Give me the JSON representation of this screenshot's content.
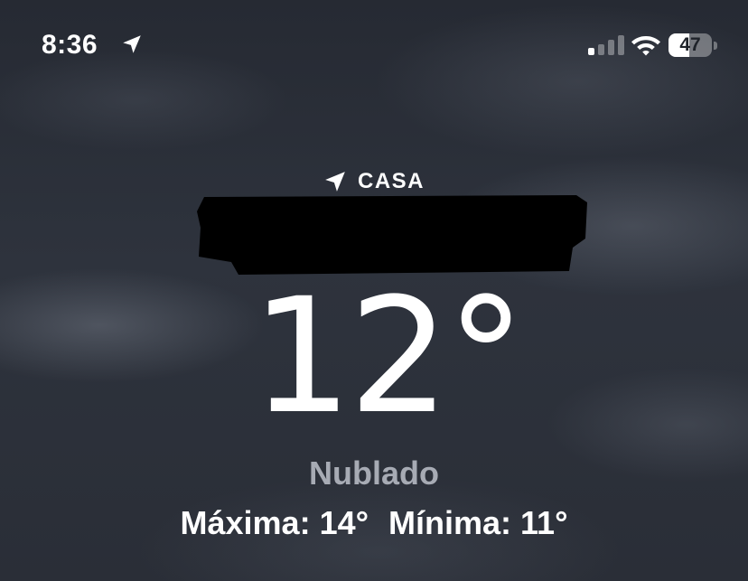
{
  "status_bar": {
    "time": "8:36",
    "battery_level": "47",
    "battery_fraction": 0.47,
    "signal_bars_active": 1,
    "signal_bars_total": 4,
    "icons": [
      "location-arrow-icon",
      "signal-bars-icon",
      "wifi-icon",
      "battery-icon"
    ]
  },
  "weather": {
    "location": "CASA",
    "location_icon": "navigation-arrow-icon",
    "temperature": "12°",
    "condition": "Nublado",
    "high": "Máxima: 14°",
    "low": "Mínima: 11°"
  },
  "colors": {
    "text_primary": "#ffffff",
    "text_secondary": "#a7abb4",
    "background": "#2b303b",
    "redaction": "#000000"
  }
}
